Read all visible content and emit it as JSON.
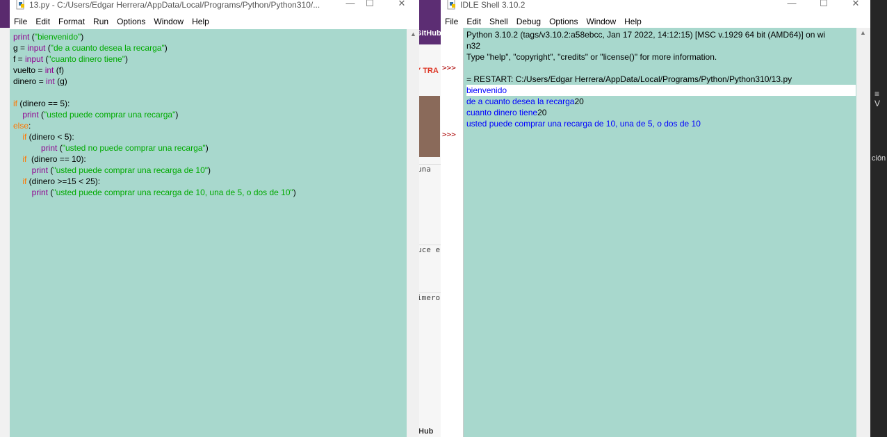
{
  "background": {
    "gh_top": "GitHub",
    "gh_bottom": "Hub",
    "red_text": "Y TRA",
    "cells": [
      "una",
      "uce e",
      "imero"
    ],
    "right_text": "ción",
    "right_icon": "≡ V"
  },
  "editor": {
    "title": "13.py - C:/Users/Edgar Herrera/AppData/Local/Programs/Python/Python310/...",
    "menu": [
      "File",
      "Edit",
      "Format",
      "Run",
      "Options",
      "Window",
      "Help"
    ],
    "code": [
      [
        {
          "t": "print",
          "c": "bi"
        },
        {
          "t": " (",
          "c": ""
        },
        {
          "t": "\"bienvenido\"",
          "c": "str"
        },
        {
          "t": ")",
          "c": ""
        }
      ],
      [
        {
          "t": "g = ",
          "c": ""
        },
        {
          "t": "input",
          "c": "bi"
        },
        {
          "t": " (",
          "c": ""
        },
        {
          "t": "\"de a cuanto desea la recarga\"",
          "c": "str"
        },
        {
          "t": ")",
          "c": ""
        }
      ],
      [
        {
          "t": "f = ",
          "c": ""
        },
        {
          "t": "input",
          "c": "bi"
        },
        {
          "t": " (",
          "c": ""
        },
        {
          "t": "\"cuanto dinero tiene\"",
          "c": "str"
        },
        {
          "t": ")",
          "c": ""
        }
      ],
      [
        {
          "t": "vuelto = ",
          "c": ""
        },
        {
          "t": "int",
          "c": "bi"
        },
        {
          "t": " (f)",
          "c": ""
        }
      ],
      [
        {
          "t": "dinero = ",
          "c": ""
        },
        {
          "t": "int",
          "c": "bi"
        },
        {
          "t": " (g)",
          "c": ""
        }
      ],
      [],
      [
        {
          "t": "if",
          "c": "kw"
        },
        {
          "t": " (dinero == 5):",
          "c": ""
        }
      ],
      [
        {
          "t": "    ",
          "c": ""
        },
        {
          "t": "print",
          "c": "bi"
        },
        {
          "t": " (",
          "c": ""
        },
        {
          "t": "\"usted puede comprar una recarga\"",
          "c": "str"
        },
        {
          "t": ")",
          "c": ""
        }
      ],
      [
        {
          "t": "else",
          "c": "kw"
        },
        {
          "t": ":",
          "c": ""
        }
      ],
      [
        {
          "t": "    ",
          "c": ""
        },
        {
          "t": "if",
          "c": "kw"
        },
        {
          "t": " (dinero < 5):",
          "c": ""
        }
      ],
      [
        {
          "t": "            ",
          "c": ""
        },
        {
          "t": "print",
          "c": "bi"
        },
        {
          "t": " (",
          "c": ""
        },
        {
          "t": "\"usted no puede comprar una recarga\"",
          "c": "str"
        },
        {
          "t": ")",
          "c": ""
        }
      ],
      [
        {
          "t": "    ",
          "c": ""
        },
        {
          "t": "if",
          "c": "kw"
        },
        {
          "t": "  (dinero == 10):",
          "c": ""
        }
      ],
      [
        {
          "t": "        ",
          "c": ""
        },
        {
          "t": "print",
          "c": "bi"
        },
        {
          "t": " (",
          "c": ""
        },
        {
          "t": "\"usted puede comprar una recarga de 10\"",
          "c": "str"
        },
        {
          "t": ")",
          "c": ""
        }
      ],
      [
        {
          "t": "    ",
          "c": ""
        },
        {
          "t": "if",
          "c": "kw"
        },
        {
          "t": " (dinero >=15 < 25):",
          "c": ""
        }
      ],
      [
        {
          "t": "        ",
          "c": ""
        },
        {
          "t": "print",
          "c": "bi"
        },
        {
          "t": " (",
          "c": ""
        },
        {
          "t": "\"usted puede comprar una recarga de 10, una de 5, o dos de 10\"",
          "c": "str"
        },
        {
          "t": ")",
          "c": ""
        }
      ]
    ]
  },
  "shell": {
    "title": "IDLE Shell 3.10.2",
    "menu": [
      "File",
      "Edit",
      "Shell",
      "Debug",
      "Options",
      "Window",
      "Help"
    ],
    "prompt": ">>>",
    "lines": [
      {
        "t": "Python 3.10.2 (tags/v3.10.2:a58ebcc, Jan 17 2022, 14:12:15) [MSC v.1929 64 bit (AMD64)] on wi",
        "c": ""
      },
      {
        "t": "n32",
        "c": ""
      },
      {
        "t": "Type \"help\", \"copyright\", \"credits\" or \"license()\" for more information.",
        "c": ""
      },
      {
        "t": "",
        "c": ""
      },
      {
        "t": "= RESTART: C:/Users/Edgar Herrera/AppData/Local/Programs/Python/Python310/13.py",
        "c": ""
      },
      {
        "t": "bienvenido",
        "c": "blue hl"
      },
      {
        "t": "de a cuanto desea la recarga",
        "c": "blue",
        "suffix": "20"
      },
      {
        "t": "cuanto dinero tiene",
        "c": "blue",
        "suffix": "20"
      },
      {
        "t": "usted puede comprar una recarga de 10, una de 5, o dos de 10",
        "c": "blue"
      }
    ]
  },
  "window_buttons": {
    "minimize": "—",
    "maximize": "☐",
    "close": "✕"
  }
}
